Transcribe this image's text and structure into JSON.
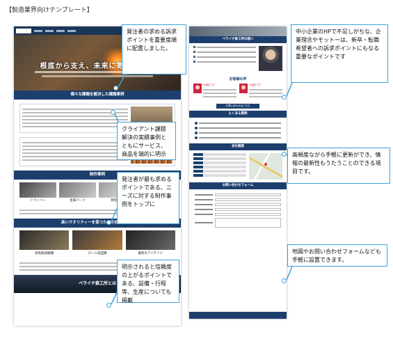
{
  "page_title": "【製造業界向けテンプレート】",
  "left_mock": {
    "hero_text": "根底から支え、未来に寄与する。",
    "sections": {
      "issues": "様々な課題を解決した課題事例",
      "products": "制作事例",
      "equipment": "高いクオリティーを保つための技術と設備",
      "about": "ベライチ鉄工所とは"
    },
    "products": [
      "ドライバー",
      "金属パーツ",
      "精密部品",
      "調理器具"
    ],
    "equipment": [
      "高性能研磨機",
      "ロール成型機",
      "最新のアイテイツ"
    ]
  },
  "right_mock": {
    "sections": {
      "thoughts": "ベライチ鉄工所の想い",
      "voices": "お客様の声",
      "faq": "よくある質問",
      "company": "会社概要",
      "contact": "お問い合わせフォーム"
    },
    "voice_names": [
      "大滝正下さ",
      "大滝正下さ"
    ],
    "button_label": "お問い合わせはこちら"
  },
  "callouts": [
    "発注者の求める訴求ポイントを重要度順に配置しました。",
    "クライアント課題解決の実績事例とともにサービス、商品を端的に明示",
    "発注者が最も求めるポイントである、ニーズに対する制作事例をトップに",
    "明示されると信頼度の上がるポイントである、設備・行程等、生産についても掲載",
    "中小企業のHPで不足しがちな、企業理念やモットーは、新卒・転職希望者への訴求ポイントにもなる重要なポイントです",
    "高頻度ながら手軽に更新ができ、情報の最新性もうたうことのできる項目です。",
    "地図やお問い合わせフォームなども手軽に設置できます。"
  ]
}
